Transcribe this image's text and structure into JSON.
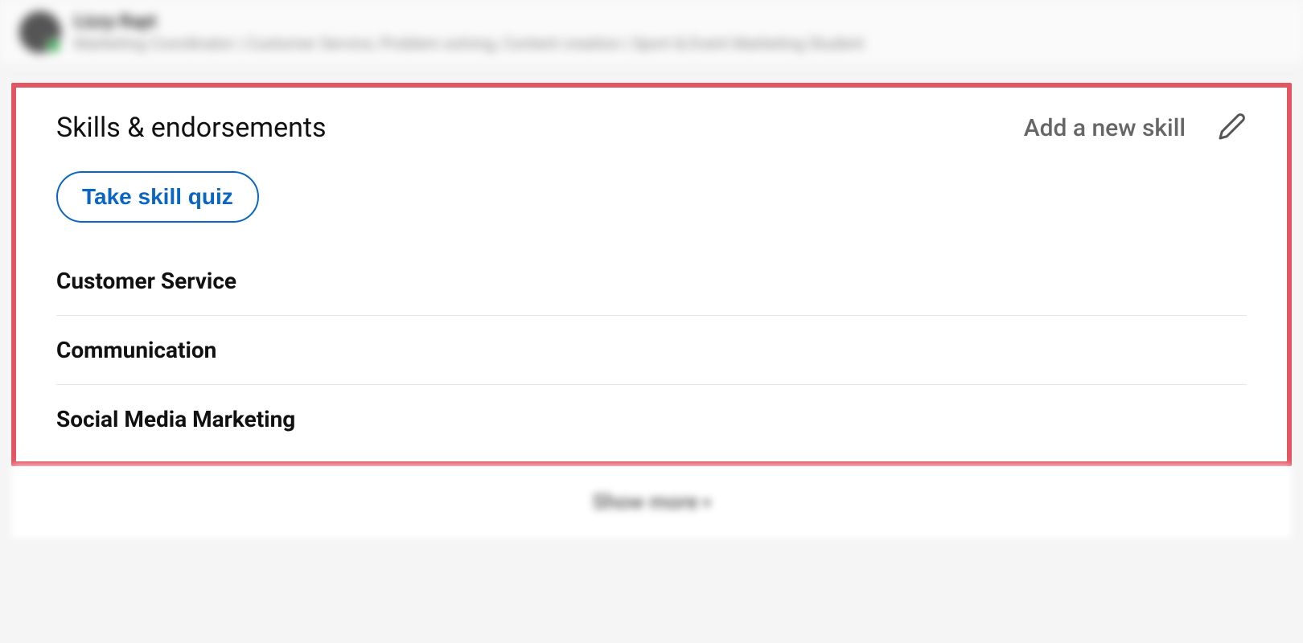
{
  "header": {
    "name": "Lizzy Rapt",
    "subtitle": "Marketing Coordinator | Customer Service, Problem solving, Content creation | Sport & Event Marketing Student"
  },
  "section": {
    "title": "Skills & endorsements",
    "add_skill_label": "Add a new skill",
    "quiz_button": "Take skill quiz",
    "skills": [
      {
        "name": "Customer Service"
      },
      {
        "name": "Communication"
      },
      {
        "name": "Social Media Marketing"
      }
    ]
  },
  "footer": {
    "show_more": "Show more"
  }
}
